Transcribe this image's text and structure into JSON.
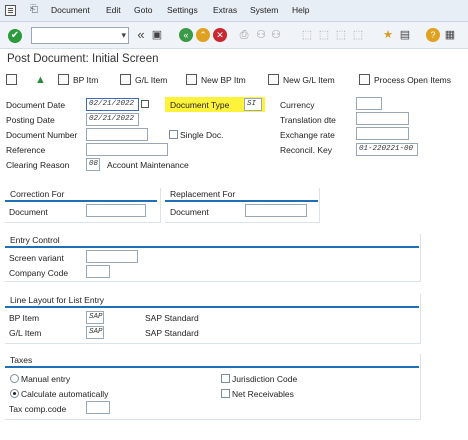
{
  "menu": {
    "document": "Document",
    "edit": "Edit",
    "goto": "Goto",
    "settings": "Settings",
    "extras": "Extras",
    "system": "System",
    "help": "Help"
  },
  "title": "Post Document: Initial Screen",
  "app_toolbar": {
    "bp_item": "BP Itm",
    "gl_item": "G/L Item",
    "new_bp_item": "New BP Itm",
    "new_gl_item": "New G/L Item",
    "process_open_items": "Process Open Items"
  },
  "header": {
    "document_date_label": "Document Date",
    "document_date": "02/21/2022",
    "posting_date_label": "Posting Date",
    "posting_date": "02/21/2022",
    "document_number_label": "Document Number",
    "document_number": "",
    "reference_label": "Reference",
    "reference": "",
    "clearing_reason_label": "Clearing Reason",
    "clearing_reason": "08",
    "clearing_reason_text": "Account Maintenance",
    "document_type_label": "Document Type",
    "document_type": "SI",
    "single_doc_label": "Single Doc.",
    "currency_label": "Currency",
    "currency": "",
    "translation_date_label": "Translation dte",
    "translation_date": "",
    "exchange_rate_label": "Exchange rate",
    "exchange_rate": "",
    "reconcil_key_label": "Reconcil. Key",
    "reconcil_key": "01-220221-00"
  },
  "correction": {
    "title": "Correction For",
    "document_label": "Document",
    "document": ""
  },
  "replacement": {
    "title": "Replacement For",
    "document_label": "Document",
    "document": ""
  },
  "entry_control": {
    "title": "Entry Control",
    "screen_variant_label": "Screen variant",
    "screen_variant": "",
    "company_code_label": "Company Code",
    "company_code": ""
  },
  "line_layout": {
    "title": "Line Layout for List Entry",
    "bp_item_label": "BP Item",
    "bp_item": "SAP",
    "bp_item_text": "SAP Standard",
    "gl_item_label": "G/L Item",
    "gl_item": "SAP",
    "gl_item_text": "SAP Standard"
  },
  "taxes": {
    "title": "Taxes",
    "manual_entry_label": "Manual entry",
    "calc_auto_label": "Calculate automatically",
    "selected": "calculate_automatically",
    "jurisdiction_code_label": "Jurisdiction Code",
    "net_receivables_label": "Net Receivables",
    "tax_comp_code_label": "Tax comp.code",
    "tax_comp_code": ""
  },
  "colors": {
    "highlight": "#fff23a",
    "group_line": "#1f6fb6",
    "check_green": "#2a9a3c"
  }
}
